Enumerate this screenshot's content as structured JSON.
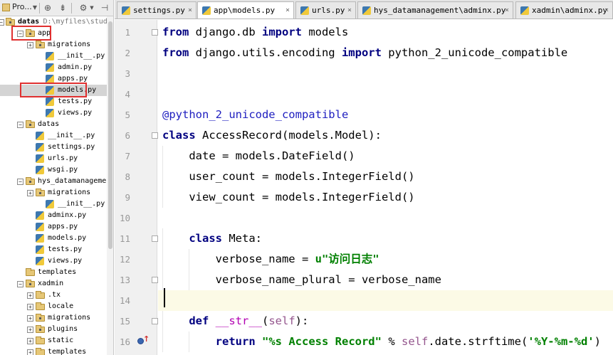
{
  "project_panel": {
    "title": "Pro...",
    "toolbar_icons": [
      "dropdown-icon",
      "target-icon",
      "collapse-icon",
      "gear-icon",
      "hide-icon"
    ],
    "tree": [
      {
        "label": "datas",
        "path": "D:\\myfiles\\study",
        "kind": "root"
      },
      {
        "label": "app",
        "kind": "package"
      },
      {
        "label": "migrations",
        "kind": "package"
      },
      {
        "label": "__init__.py",
        "kind": "py"
      },
      {
        "label": "admin.py",
        "kind": "py"
      },
      {
        "label": "apps.py",
        "kind": "py"
      },
      {
        "label": "models.py",
        "kind": "py",
        "selected": true
      },
      {
        "label": "tests.py",
        "kind": "py"
      },
      {
        "label": "views.py",
        "kind": "py"
      },
      {
        "label": "datas",
        "kind": "package"
      },
      {
        "label": "__init__.py",
        "kind": "py"
      },
      {
        "label": "settings.py",
        "kind": "py"
      },
      {
        "label": "urls.py",
        "kind": "py"
      },
      {
        "label": "wsgi.py",
        "kind": "py"
      },
      {
        "label": "hys_datamanagement",
        "kind": "package"
      },
      {
        "label": "migrations",
        "kind": "package"
      },
      {
        "label": "__init__.py",
        "kind": "py"
      },
      {
        "label": "adminx.py",
        "kind": "py"
      },
      {
        "label": "apps.py",
        "kind": "py"
      },
      {
        "label": "models.py",
        "kind": "py"
      },
      {
        "label": "tests.py",
        "kind": "py"
      },
      {
        "label": "views.py",
        "kind": "py"
      },
      {
        "label": "templates",
        "kind": "folder"
      },
      {
        "label": "xadmin",
        "kind": "package"
      },
      {
        "label": ".tx",
        "kind": "folder"
      },
      {
        "label": "locale",
        "kind": "folder"
      },
      {
        "label": "migrations",
        "kind": "package"
      },
      {
        "label": "plugins",
        "kind": "package"
      },
      {
        "label": "static",
        "kind": "folder"
      },
      {
        "label": "templates",
        "kind": "folder"
      }
    ]
  },
  "tabs": [
    {
      "label": "settings.py",
      "close": "×"
    },
    {
      "label": "app\\models.py",
      "close": "×",
      "active": true
    },
    {
      "label": "urls.py",
      "close": "×"
    },
    {
      "label": "hys_datamanagement\\adminx.py",
      "close": "×"
    },
    {
      "label": "xadmin\\adminx.py",
      "close": "×"
    }
  ],
  "editor": {
    "current_line": 14,
    "lines": [
      {
        "num": "1",
        "text": "from django.db import models"
      },
      {
        "num": "2",
        "text": "from django.utils.encoding import python_2_unicode_compatible"
      },
      {
        "num": "3",
        "text": ""
      },
      {
        "num": "4",
        "text": ""
      },
      {
        "num": "5",
        "text": "@python_2_unicode_compatible"
      },
      {
        "num": "6",
        "text": "class AccessRecord(models.Model):"
      },
      {
        "num": "7",
        "text": "    date = models.DateField()"
      },
      {
        "num": "8",
        "text": "    user_count = models.IntegerField()"
      },
      {
        "num": "9",
        "text": "    view_count = models.IntegerField()"
      },
      {
        "num": "10",
        "text": ""
      },
      {
        "num": "11",
        "text": "    class Meta:"
      },
      {
        "num": "12",
        "text": "        verbose_name = u\"访问日志\""
      },
      {
        "num": "13",
        "text": "        verbose_name_plural = verbose_name"
      },
      {
        "num": "14",
        "text": ""
      },
      {
        "num": "15",
        "text": "    def __str__(self):"
      },
      {
        "num": "16",
        "text": "        return \"%s Access Record\" % self.date.strftime('%Y-%m-%d')"
      }
    ]
  },
  "colors": {
    "keyword": "#000080",
    "string": "#008000",
    "decorator": "#2020c0",
    "self": "#94558d",
    "highlight_box": "#e03030",
    "current_line": "#fcfae6"
  }
}
